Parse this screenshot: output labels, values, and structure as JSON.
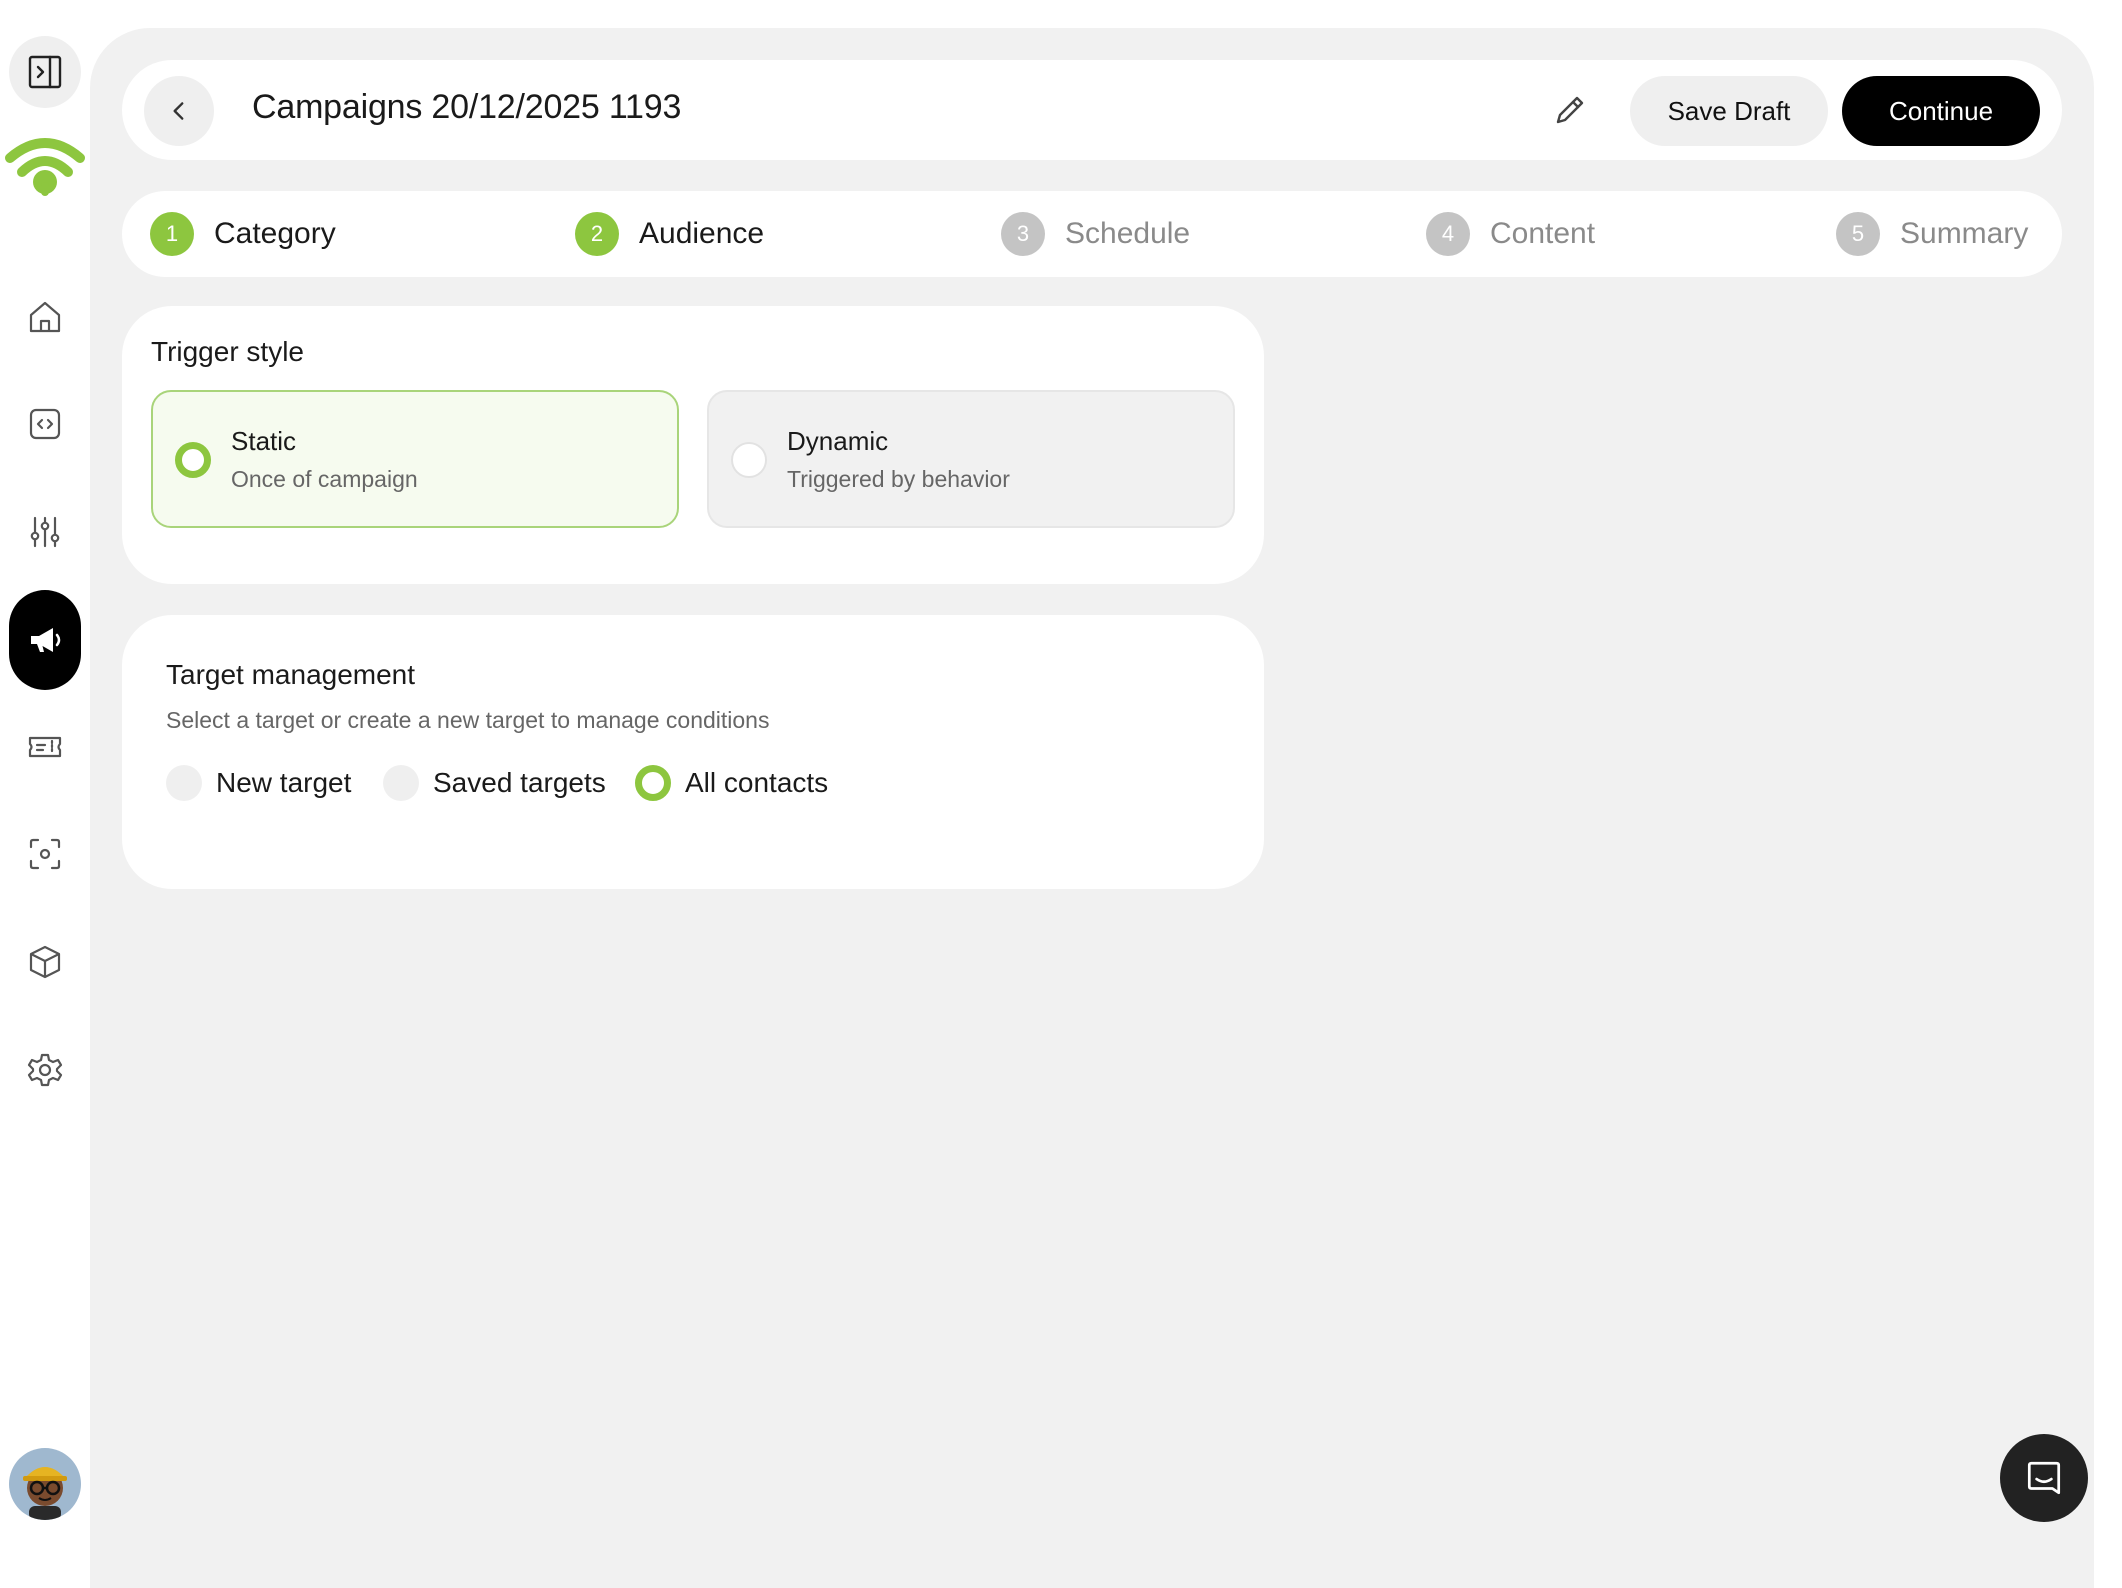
{
  "sidebar": {
    "toggle_icon": "sidebar-toggle-icon",
    "logo_icon": "wifi-logo-icon",
    "brand_color": "#8dc63f",
    "items": [
      {
        "icon": "home-icon"
      },
      {
        "icon": "code-icon"
      },
      {
        "icon": "sliders-icon"
      },
      {
        "icon": "megaphone-icon",
        "active": true
      },
      {
        "icon": "ticket-icon"
      },
      {
        "icon": "scan-icon"
      },
      {
        "icon": "cube-icon"
      },
      {
        "icon": "settings-icon"
      }
    ],
    "avatar": "user-avatar"
  },
  "header": {
    "title": "Campaigns 20/12/2025 1193",
    "save_label": "Save Draft",
    "continue_label": "Continue"
  },
  "stepper": {
    "steps": [
      {
        "num": "1",
        "label": "Category",
        "state": "done"
      },
      {
        "num": "2",
        "label": "Audience",
        "state": "done"
      },
      {
        "num": "3",
        "label": "Schedule",
        "state": "todo"
      },
      {
        "num": "4",
        "label": "Content",
        "state": "todo"
      },
      {
        "num": "5",
        "label": "Summary",
        "state": "todo"
      }
    ]
  },
  "trigger": {
    "title": "Trigger style",
    "options": [
      {
        "title": "Static",
        "desc": "Once of campaign",
        "selected": true
      },
      {
        "title": "Dynamic",
        "desc": "Triggered by behavior",
        "selected": false
      }
    ]
  },
  "target": {
    "title": "Target management",
    "subtitle": "Select a target or create a new target to manage conditions",
    "options": [
      {
        "label": "New target",
        "selected": false
      },
      {
        "label": "Saved targets",
        "selected": false
      },
      {
        "label": "All contacts",
        "selected": true
      }
    ]
  },
  "colors": {
    "accent": "#8dc63f",
    "primary_button": "#000000",
    "canvas": "#f1f1f1"
  }
}
